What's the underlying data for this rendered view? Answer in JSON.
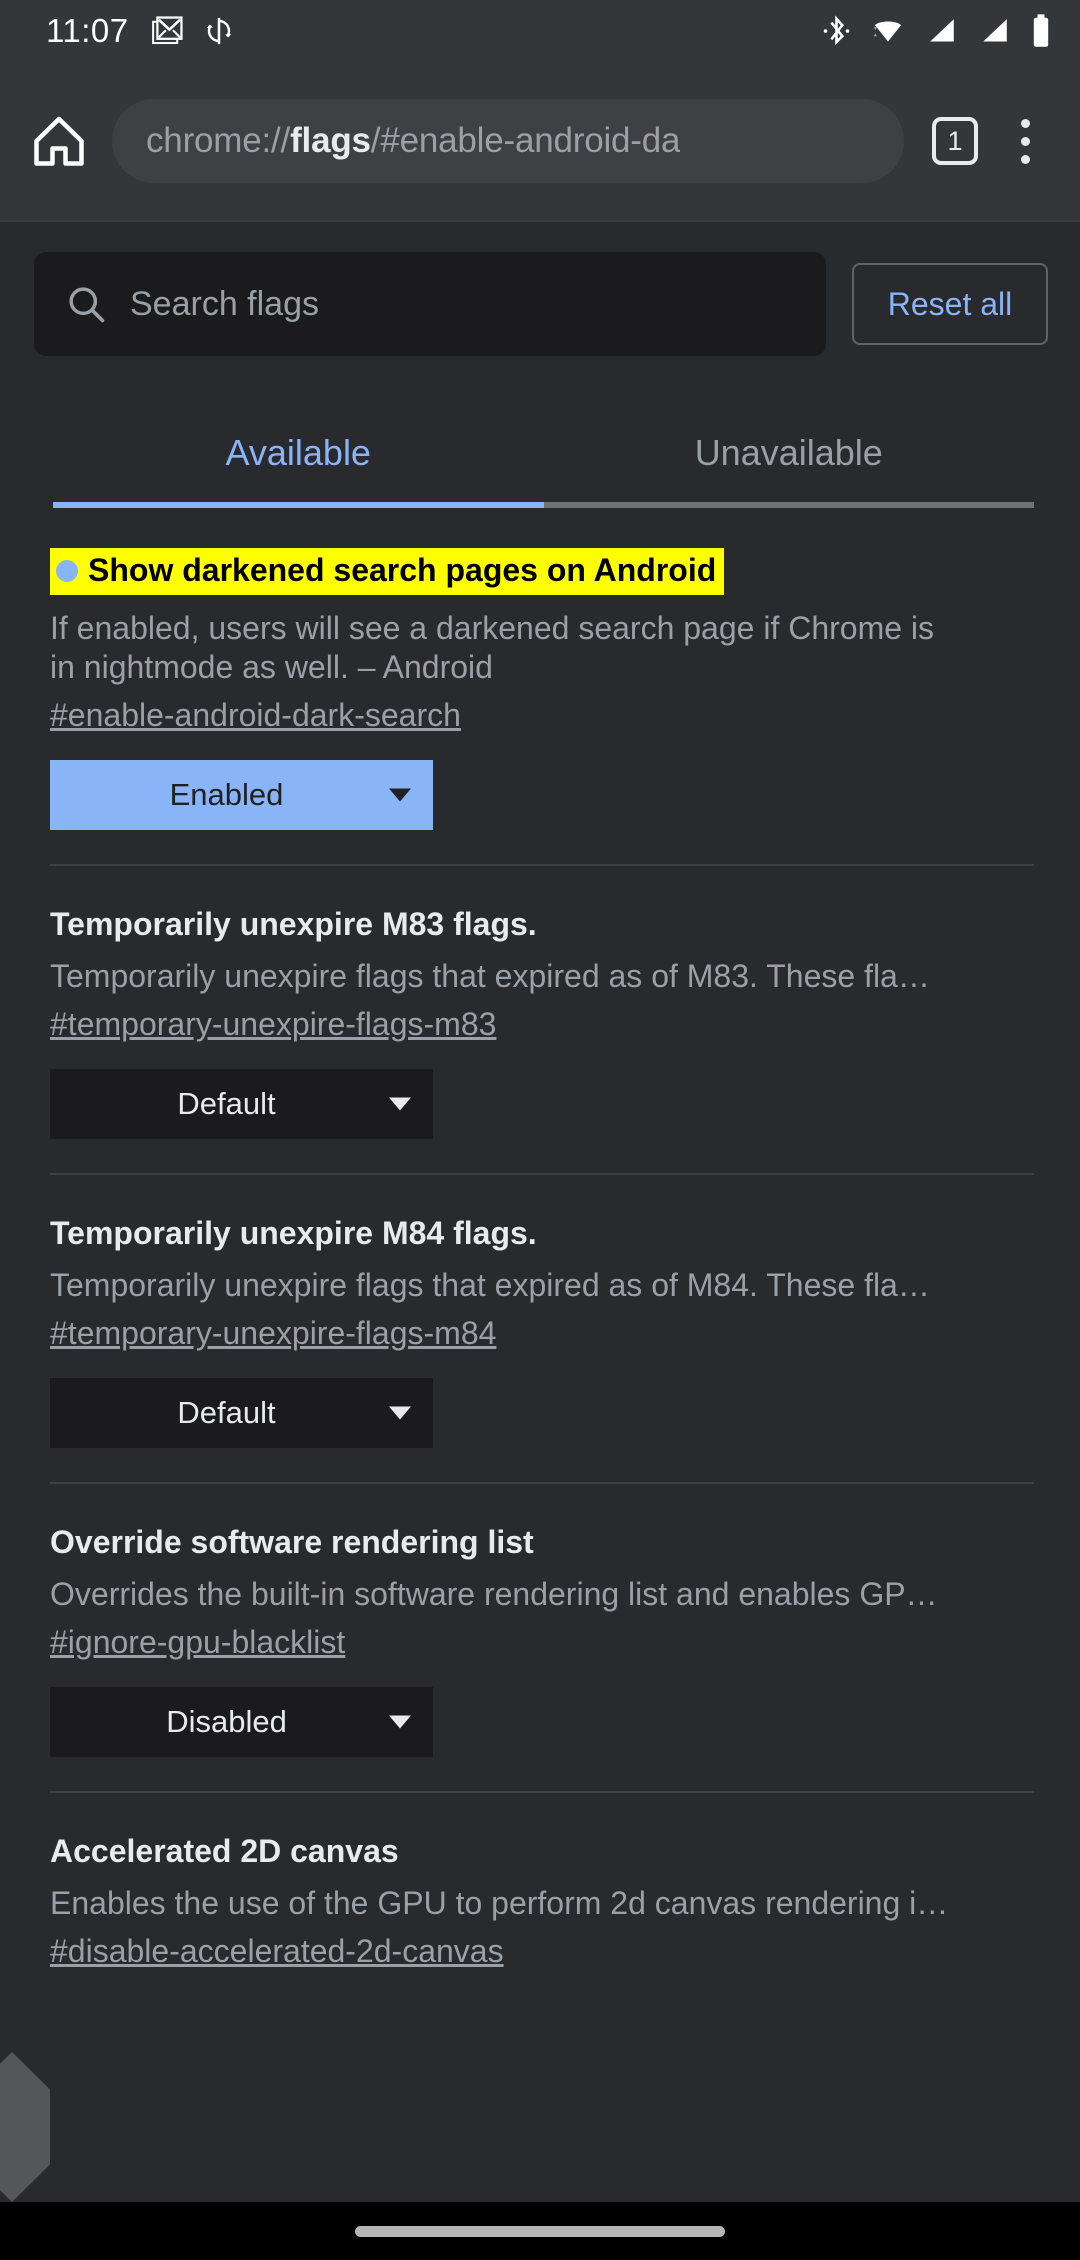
{
  "status_bar": {
    "time": "11:07",
    "left_icons": [
      "gmail-icon",
      "sync-icon"
    ],
    "right_icons": [
      "bluetooth-icon",
      "wifi-icon",
      "signal-1-icon",
      "signal-2-icon",
      "battery-icon"
    ]
  },
  "toolbar": {
    "home_icon": "home-icon",
    "url_prefix": "chrome://",
    "url_bold": "flags",
    "url_suffix": "/#enable-android-da",
    "tab_count": "1",
    "menu_icon": "overflow-menu-icon"
  },
  "search": {
    "placeholder": "Search flags",
    "icon": "search-icon",
    "reset_label": "Reset all"
  },
  "tabs": [
    {
      "label": "Available",
      "active": true
    },
    {
      "label": "Unavailable",
      "active": false
    }
  ],
  "flags": [
    {
      "title": "Show darkened search pages on Android",
      "highlighted": true,
      "bullet": true,
      "description": "If enabled, users will see a darkened search page if Chrome is\nin nightmode as well. – Android",
      "link": "#enable-android-dark-search",
      "select_value": "Enabled",
      "select_state": "enabled"
    },
    {
      "title": "Temporarily unexpire M83 flags.",
      "highlighted": false,
      "bullet": false,
      "description": "Temporarily unexpire flags that expired as of M83. These fla…",
      "link": "#temporary-unexpire-flags-m83",
      "select_value": "Default",
      "select_state": "default"
    },
    {
      "title": "Temporarily unexpire M84 flags.",
      "highlighted": false,
      "bullet": false,
      "description": "Temporarily unexpire flags that expired as of M84. These fla…",
      "link": "#temporary-unexpire-flags-m84",
      "select_value": "Default",
      "select_state": "default"
    },
    {
      "title": "Override software rendering list",
      "highlighted": false,
      "bullet": false,
      "description": "Overrides the built-in software rendering list and enables GP…",
      "link": "#ignore-gpu-blacklist",
      "select_value": "Disabled",
      "select_state": "default"
    },
    {
      "title": "Accelerated 2D canvas",
      "highlighted": false,
      "bullet": false,
      "description": "Enables the use of the GPU to perform 2d canvas rendering i…",
      "link": "#disable-accelerated-2d-canvas",
      "select_value": "",
      "select_state": "hidden"
    }
  ],
  "navigation": {
    "home_indicator": "home-indicator",
    "back_gesture": "back-gesture-handle"
  },
  "colors": {
    "page_bg": "#292a2d",
    "chrome_bg": "#35363a",
    "accent_blue": "#8ab4f8",
    "highlight_yellow": "#ffff00",
    "text_primary": "#e8eaed",
    "text_secondary": "#9aa0a6"
  }
}
